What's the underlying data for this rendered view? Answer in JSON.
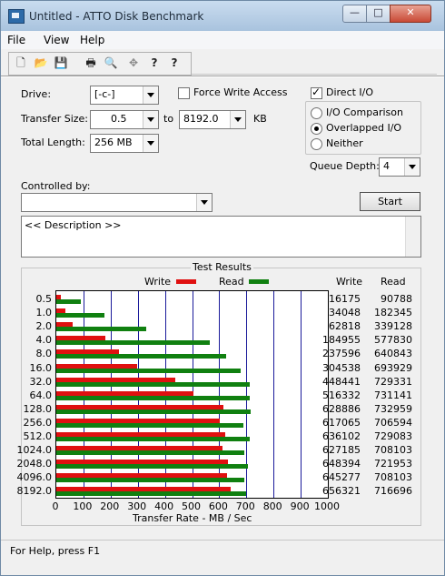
{
  "window": {
    "title": "Untitled - ATTO Disk Benchmark",
    "minimize": "—",
    "maximize": "□",
    "close": "✕"
  },
  "menu": [
    "File",
    "View",
    "Help"
  ],
  "toolbar": {
    "icons": [
      "new-file-icon",
      "open-folder-icon",
      "save-icon",
      "print-icon",
      "print-preview-icon",
      "move-icon",
      "help-icon",
      "context-help-icon"
    ],
    "glyphs": [
      "🗋",
      "📂",
      "💾",
      "🖶",
      "🔍",
      "✥",
      "?",
      "?"
    ]
  },
  "form": {
    "drive_label": "Drive:",
    "drive_value": "[-c-]",
    "force_write_label": "Force Write Access",
    "force_write_checked": false,
    "direct_io_label": "Direct I/O",
    "direct_io_checked": true,
    "transfer_size_label": "Transfer Size:",
    "transfer_from": "0.5",
    "to_label": "to",
    "transfer_to": "8192.0",
    "kb_label": "KB",
    "total_length_label": "Total Length:",
    "total_length_value": "256 MB",
    "io_modes": [
      {
        "label": "I/O Comparison",
        "selected": false
      },
      {
        "label": "Overlapped I/O",
        "selected": true
      },
      {
        "label": "Neither",
        "selected": false
      }
    ],
    "queue_depth_label": "Queue Depth:",
    "queue_depth_value": "4",
    "controlled_by_label": "Controlled by:",
    "controlled_by_value": "",
    "start_button": "Start",
    "description": "<< Description >>"
  },
  "results": {
    "title": "Test Results",
    "legend_write": "Write",
    "legend_read": "Read",
    "col_write": "Write",
    "col_read": "Read",
    "xaxis_label": "Transfer Rate - MB / Sec"
  },
  "chart_data": {
    "type": "bar",
    "orientation": "horizontal",
    "title": "Test Results",
    "xlabel": "Transfer Rate - MB / Sec",
    "xlim": [
      0,
      1000
    ],
    "xticks": [
      "0",
      "100",
      "200",
      "300",
      "400",
      "500",
      "600",
      "700",
      "800",
      "900",
      "1000"
    ],
    "categories": [
      "0.5",
      "1.0",
      "2.0",
      "4.0",
      "8.0",
      "16.0",
      "32.0",
      "64.0",
      "128.0",
      "256.0",
      "512.0",
      "1024.0",
      "2048.0",
      "4096.0",
      "8192.0"
    ],
    "series": [
      {
        "name": "Write",
        "color": "#e01010",
        "values": [
          16175,
          34048,
          62818,
          184955,
          237596,
          304538,
          448441,
          516332,
          628886,
          617065,
          636102,
          627185,
          648394,
          645277,
          656321
        ]
      },
      {
        "name": "Read",
        "color": "#108010",
        "values": [
          90788,
          182345,
          339128,
          577830,
          640843,
          693929,
          729331,
          731141,
          732959,
          706594,
          729083,
          708103,
          721953,
          708103,
          716696
        ]
      }
    ],
    "grid": true
  },
  "status": "For Help, press F1"
}
